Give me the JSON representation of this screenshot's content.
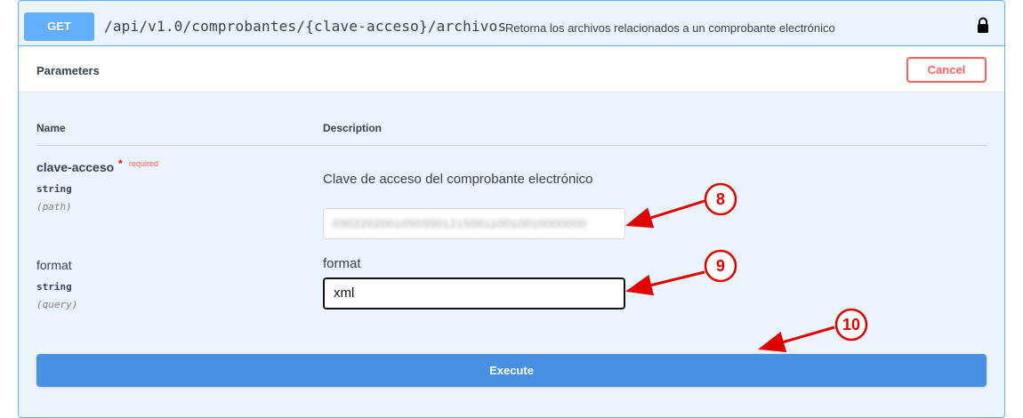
{
  "operation": {
    "method": "GET",
    "path": "/api/v1.0/comprobantes/{clave-acceso}/archivos",
    "summary": "Retorna los archivos relacionados a un comprobante electrónico",
    "lock_icon": "lock-icon"
  },
  "parameters": {
    "title": "Parameters",
    "cancel_label": "Cancel",
    "headers": {
      "name": "Name",
      "description": "Description"
    },
    "items": [
      {
        "name": "clave-acceso",
        "required_star": "*",
        "required_label": "required",
        "type": "string",
        "in": "(path)",
        "description": "Clave de acceso del comprobante electrónico",
        "value": "0302202001050350121500110010010000000"
      },
      {
        "name": "format",
        "type": "string",
        "in": "(query)",
        "description": "format",
        "value": "xml"
      }
    ]
  },
  "execute_label": "Execute",
  "annotations": [
    {
      "label": "8",
      "color": "#e10000"
    },
    {
      "label": "9",
      "color": "#e10000"
    },
    {
      "label": "10",
      "color": "#e10000"
    }
  ],
  "colors": {
    "get_method": "#61affe",
    "execute": "#4990e2",
    "cancel": "#ff6060",
    "annotation": "#e10000"
  }
}
